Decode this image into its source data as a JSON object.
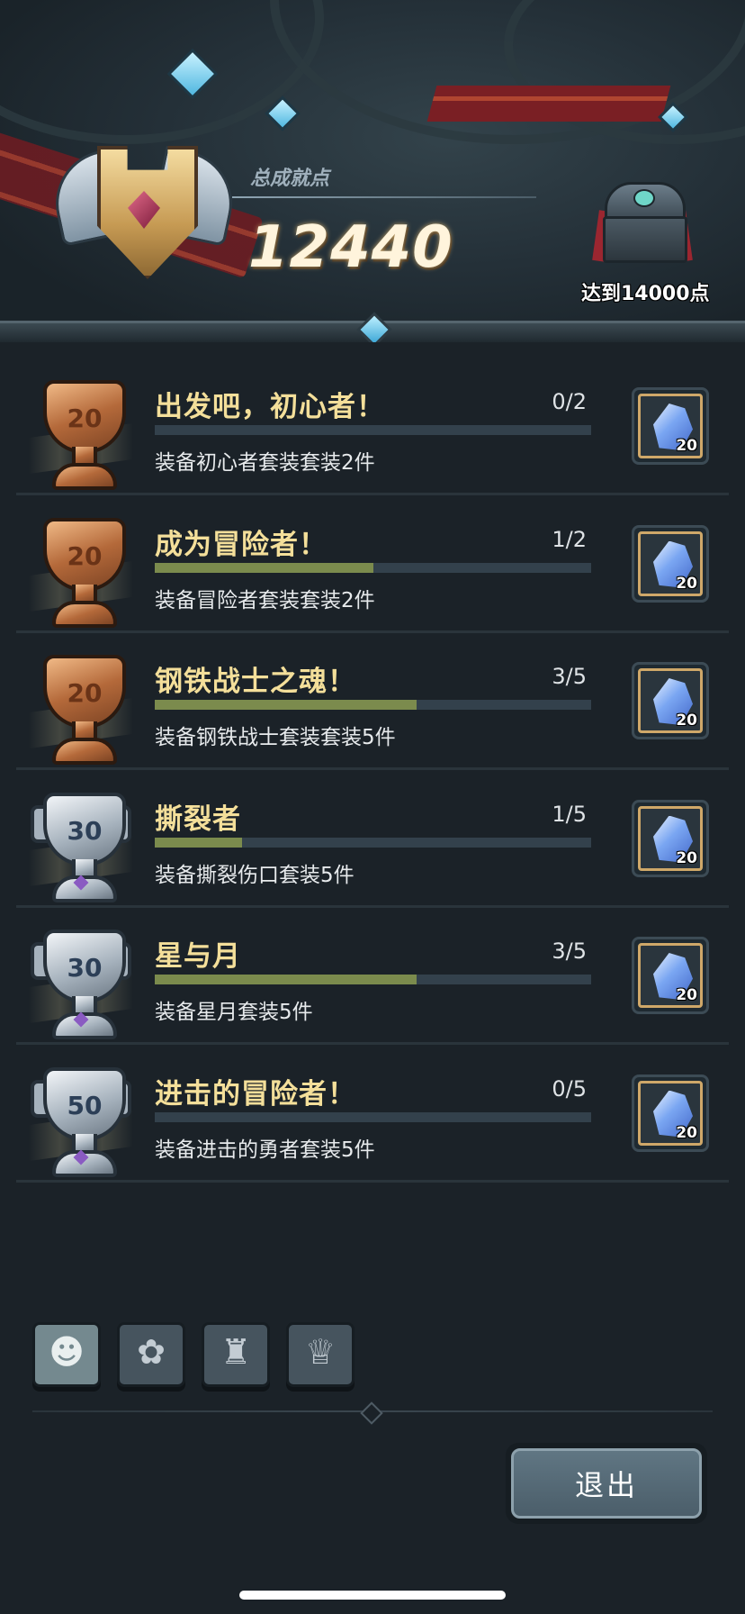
{
  "header": {
    "score_label": "总成就点",
    "score_value": "12440",
    "chest_caption": "达到14000点"
  },
  "achievements": [
    {
      "title": "出发吧，初心者！",
      "progress_text": "0/2",
      "progress": 0.0,
      "description": "装备初心者套装套装2件",
      "trophy_tier": "bronze",
      "trophy_points": "20",
      "reward_icon": "crystal-icon",
      "reward_qty": "20"
    },
    {
      "title": "成为冒险者！",
      "progress_text": "1/2",
      "progress": 0.5,
      "description": "装备冒险者套装套装2件",
      "trophy_tier": "bronze",
      "trophy_points": "20",
      "reward_icon": "crystal-icon",
      "reward_qty": "20"
    },
    {
      "title": "钢铁战士之魂！",
      "progress_text": "3/5",
      "progress": 0.6,
      "description": "装备钢铁战士套装套装5件",
      "trophy_tier": "bronze",
      "trophy_points": "20",
      "reward_icon": "crystal-icon",
      "reward_qty": "20"
    },
    {
      "title": "撕裂者",
      "progress_text": "1/5",
      "progress": 0.2,
      "description": "装备撕裂伤口套装5件",
      "trophy_tier": "silver",
      "trophy_points": "30",
      "reward_icon": "crystal-icon",
      "reward_qty": "20"
    },
    {
      "title": "星与月",
      "progress_text": "3/5",
      "progress": 0.6,
      "description": "装备星月套装5件",
      "trophy_tier": "silver",
      "trophy_points": "30",
      "reward_icon": "crystal-icon",
      "reward_qty": "20"
    },
    {
      "title": "进击的冒险者！",
      "progress_text": "0/5",
      "progress": 0.0,
      "description": "装备进击的勇者套装5件",
      "trophy_tier": "silver",
      "trophy_points": "50",
      "reward_icon": "crystal-icon",
      "reward_qty": "20"
    }
  ],
  "tabs": [
    {
      "icon": "character-head-icon",
      "glyph": "☻",
      "active": true
    },
    {
      "icon": "paw-icon",
      "glyph": "✿",
      "active": false
    },
    {
      "icon": "demon-mask-icon",
      "glyph": "♜",
      "active": false
    },
    {
      "icon": "trophy-icon",
      "glyph": "♕",
      "active": false
    }
  ],
  "exit_label": "退出",
  "colors": {
    "background": "#1b2228",
    "title_gold": "#f4df9a",
    "progress_fill": "#7b8b4d",
    "progress_track": "#33414c"
  }
}
